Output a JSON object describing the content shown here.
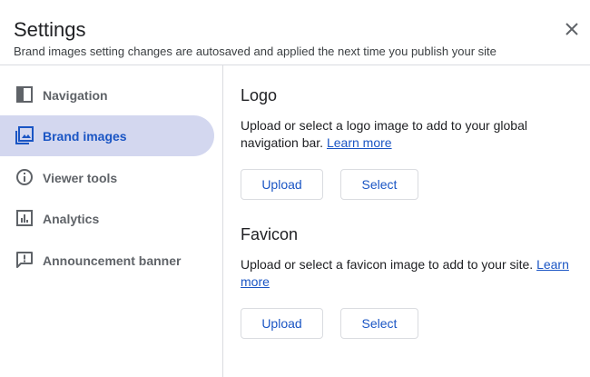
{
  "header": {
    "title": "Settings",
    "subtitle": "Brand images setting changes are autosaved and applied the next time you publish your site"
  },
  "sidebar": {
    "items": [
      {
        "label": "Navigation",
        "icon": "navigation-panel-icon",
        "active": false
      },
      {
        "label": "Brand images",
        "icon": "image-gallery-icon",
        "active": true
      },
      {
        "label": "Viewer tools",
        "icon": "info-icon",
        "active": false
      },
      {
        "label": "Analytics",
        "icon": "analytics-icon",
        "active": false
      },
      {
        "label": "Announcement banner",
        "icon": "announcement-icon",
        "active": false
      }
    ]
  },
  "logo": {
    "title": "Logo",
    "description": "Upload or select a logo image to add to your global navigation bar.",
    "link": "Learn more",
    "upload_label": "Upload",
    "select_label": "Select"
  },
  "favicon": {
    "title": "Favicon",
    "description": "Upload or select a favicon image to add to your site.",
    "link": "Learn more",
    "upload_label": "Upload",
    "select_label": "Select"
  },
  "colors": {
    "accent": "#1a55c4",
    "active_bg": "#d3d7ef",
    "muted_text": "#5f6368",
    "divider": "#dadce0"
  }
}
